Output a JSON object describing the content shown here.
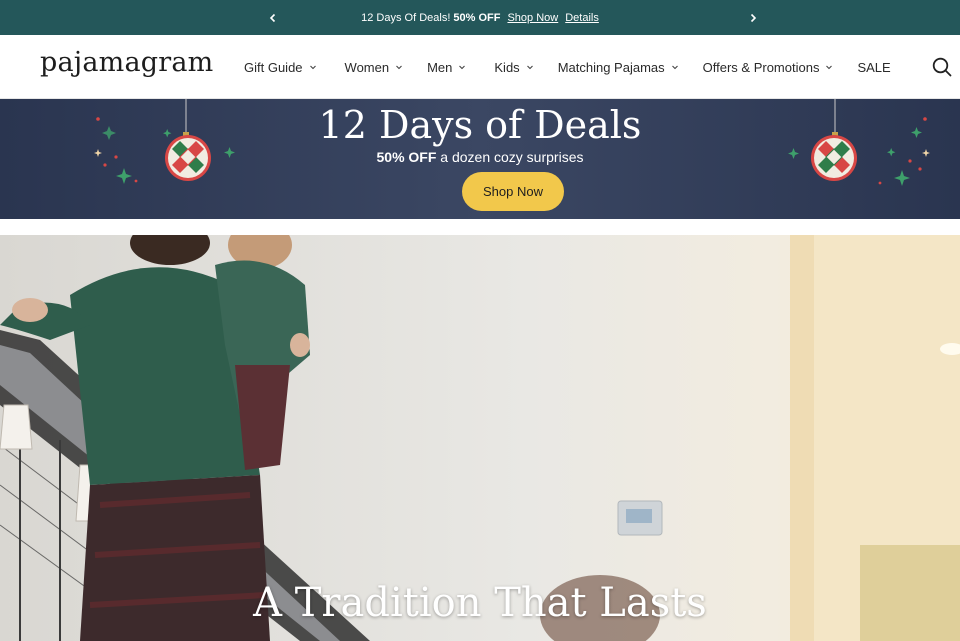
{
  "announcement": {
    "text": "12 Days Of Deals!",
    "highlight": "50% OFF",
    "shop_link": "Shop Now",
    "details_link": "Details",
    "background": "#24575a"
  },
  "header": {
    "logo": "pajamagram",
    "nav": [
      {
        "label": "Gift Guide",
        "has_dropdown": true
      },
      {
        "label": "Women",
        "has_dropdown": true
      },
      {
        "label": "Men",
        "has_dropdown": true
      },
      {
        "label": "Kids",
        "has_dropdown": true
      },
      {
        "label": "Matching Pajamas",
        "has_dropdown": true
      },
      {
        "label": "Offers & Promotions",
        "has_dropdown": true
      },
      {
        "label": "SALE",
        "has_dropdown": false
      }
    ],
    "search_icon": "search-icon"
  },
  "promo": {
    "title": "12 Days of Deals",
    "highlight": "50% OFF",
    "subtitle": "a dozen cozy surprises",
    "button": "Shop Now",
    "button_color": "#f2c84b",
    "background": "#2f3a55"
  },
  "hero": {
    "headline": "A Tradition That Lasts"
  }
}
